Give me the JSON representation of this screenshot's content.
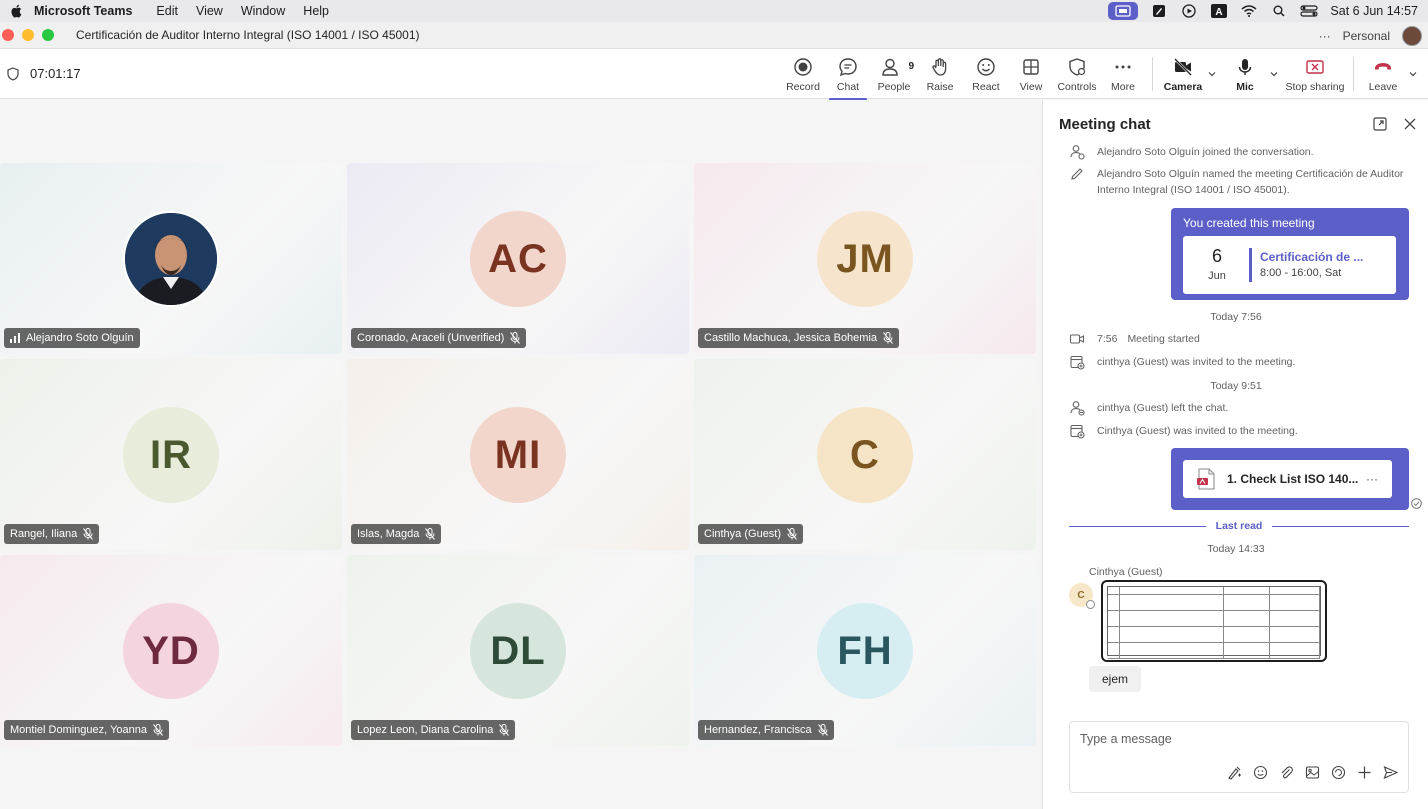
{
  "menubar": {
    "app_name": "Microsoft Teams",
    "items": [
      "Edit",
      "View",
      "Window",
      "Help"
    ],
    "clock": "Sat 6 Jun  14:57"
  },
  "titlebar": {
    "title": "Certificación de Auditor Interno Integral (ISO 14001 / ISO 45001)",
    "more": "···",
    "profile": "Personal"
  },
  "toolbar": {
    "timer": "07:01:17",
    "buttons": {
      "record": "Record",
      "chat": "Chat",
      "people": "People",
      "people_count": "9",
      "raise": "Raise",
      "react": "React",
      "view": "View",
      "controls": "Controls",
      "more": "More",
      "camera": "Camera",
      "mic": "Mic",
      "stop_sharing": "Stop sharing",
      "leave": "Leave"
    }
  },
  "participants": [
    {
      "name": "Alejandro Soto Olguín",
      "initials": "",
      "photo": true,
      "bg": "#e8f0f2",
      "avatar_bg": "#1c3556",
      "avatar_fg": "#ffffff"
    },
    {
      "name": "Coronado, Araceli (Unverified)",
      "initials": "AC",
      "photo": false,
      "bg": "#eceaf4",
      "avatar_bg": "#f2d6cc",
      "avatar_fg": "#7a3320"
    },
    {
      "name": "Castillo Machuca, Jessica Bohemia",
      "initials": "JM",
      "photo": false,
      "bg": "#f6e9ee",
      "avatar_bg": "#f6e4cc",
      "avatar_fg": "#7a5520"
    },
    {
      "name": "Rangel, Iliana",
      "initials": "IR",
      "photo": false,
      "bg": "#eef1ea",
      "avatar_bg": "#e8ecda",
      "avatar_fg": "#4a5a2e"
    },
    {
      "name": "Islas, Magda",
      "initials": "MI",
      "photo": false,
      "bg": "#f5efea",
      "avatar_bg": "#f2d6cc",
      "avatar_fg": "#7a3320"
    },
    {
      "name": "Cinthya (Guest)",
      "initials": "C",
      "photo": false,
      "bg": "#eef2ec",
      "avatar_bg": "#f6e4c6",
      "avatar_fg": "#7a5520"
    },
    {
      "name": "Montiel Dominguez, Yoanna",
      "initials": "YD",
      "photo": false,
      "bg": "#f6eaee",
      "avatar_bg": "#f4d4de",
      "avatar_fg": "#6e2a3e"
    },
    {
      "name": "Lopez Leon, Diana Carolina",
      "initials": "DL",
      "photo": false,
      "bg": "#eef2ec",
      "avatar_bg": "#d6e6dc",
      "avatar_fg": "#2e4a38"
    },
    {
      "name": "Hernandez, Francisca",
      "initials": "FH",
      "photo": false,
      "bg": "#eaf1f4",
      "avatar_bg": "#d6eef2",
      "avatar_fg": "#2a5660"
    }
  ],
  "chat": {
    "title": "Meeting chat",
    "sys1": "Alejandro Soto Olguín joined the conversation.",
    "sys2": "Alejandro Soto Olguín named the meeting Certificación de Auditor Interno Integral (ISO 14001 / ISO 45001).",
    "card": {
      "header": "You created this meeting",
      "day": "6",
      "month": "Jun",
      "name": "Certificación de ...",
      "time": "8:00 - 16:00, Sat"
    },
    "date1": "Today 7:56",
    "started_time": "7:56",
    "started": "Meeting started",
    "invited1": "cinthya (Guest) was invited to the meeting.",
    "date2": "Today 9:51",
    "left": "cinthya (Guest) left the chat.",
    "invited2": "Cinthya (Guest) was invited to the meeting.",
    "file_name": "1. Check List ISO 140...",
    "file_more": "···",
    "last_read": "Last read",
    "date3": "Today 14:33",
    "sender": "Cinthya (Guest)",
    "sender_initial": "C",
    "message": "ejem",
    "composer_placeholder": "Type a message"
  }
}
